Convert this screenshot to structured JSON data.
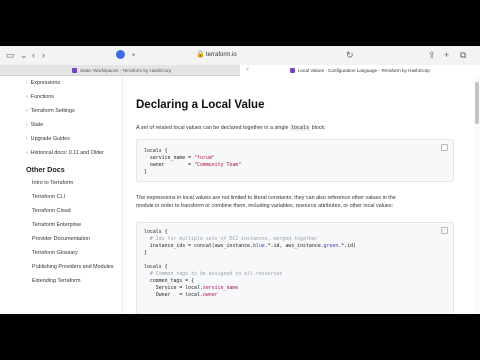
{
  "browser": {
    "url": "terraform.io",
    "tabs": [
      {
        "title": "State: Workspaces - Terraform by HashiCorp",
        "active": false
      },
      {
        "title": "Local Values - Configuration Language - Terraform by HashiCorp",
        "active": true
      }
    ]
  },
  "sidebar": {
    "items_top": [
      {
        "label": "Expressions"
      },
      {
        "label": "Functions"
      },
      {
        "label": "Terraform Settings"
      },
      {
        "label": "State"
      },
      {
        "label": "Upgrade Guides"
      },
      {
        "label": "Historical docs: 0.11 and Older"
      }
    ],
    "other_docs_heading": "Other Docs",
    "other_docs": [
      {
        "label": "Intro to Terraform"
      },
      {
        "label": "Terraform CLI"
      },
      {
        "label": "Terraform Cloud"
      },
      {
        "label": "Terraform Enterprise"
      },
      {
        "label": "Provider Documentation"
      },
      {
        "label": "Terraform Glossary"
      },
      {
        "label": "Publishing Providers and Modules"
      },
      {
        "label": "Extending Terraform"
      }
    ]
  },
  "main": {
    "title": "Declaring a Local Value",
    "intro_before": "A set of related local values can be declared together in a single ",
    "intro_code": "locals",
    "intro_after": " block:",
    "code1": {
      "l1": "locals {",
      "l2a": "  service_name = ",
      "l2b": "\"forum\"",
      "l3a": "  owner        = ",
      "l3b": "\"Community Team\"",
      "l4": "}"
    },
    "para2_line1": "The expressions in local values are not limited to literal constants; they can also reference other values in the",
    "para2_line2": "module in order to transform or combine them, including variables, resource attributes, or other local values:",
    "code2": {
      "l1": "locals {",
      "l2": "  # Ids for multiple sets of EC2 instances, merged together",
      "l3a": "  instance_ids = concat(aws_instance.",
      "l3b": "blue",
      "l3c": ".*.id, aws_instance.",
      "l3d": "green",
      "l3e": ".*.id)",
      "l4": "}",
      "l5": "locals {",
      "l6": "  # Common tags to be assigned to all resources",
      "l7": "  common_tags = {",
      "l8a": "    Service = local.",
      "l8b": "service_name",
      "l9a": "    Owner   = local.",
      "l9b": "owner"
    }
  }
}
